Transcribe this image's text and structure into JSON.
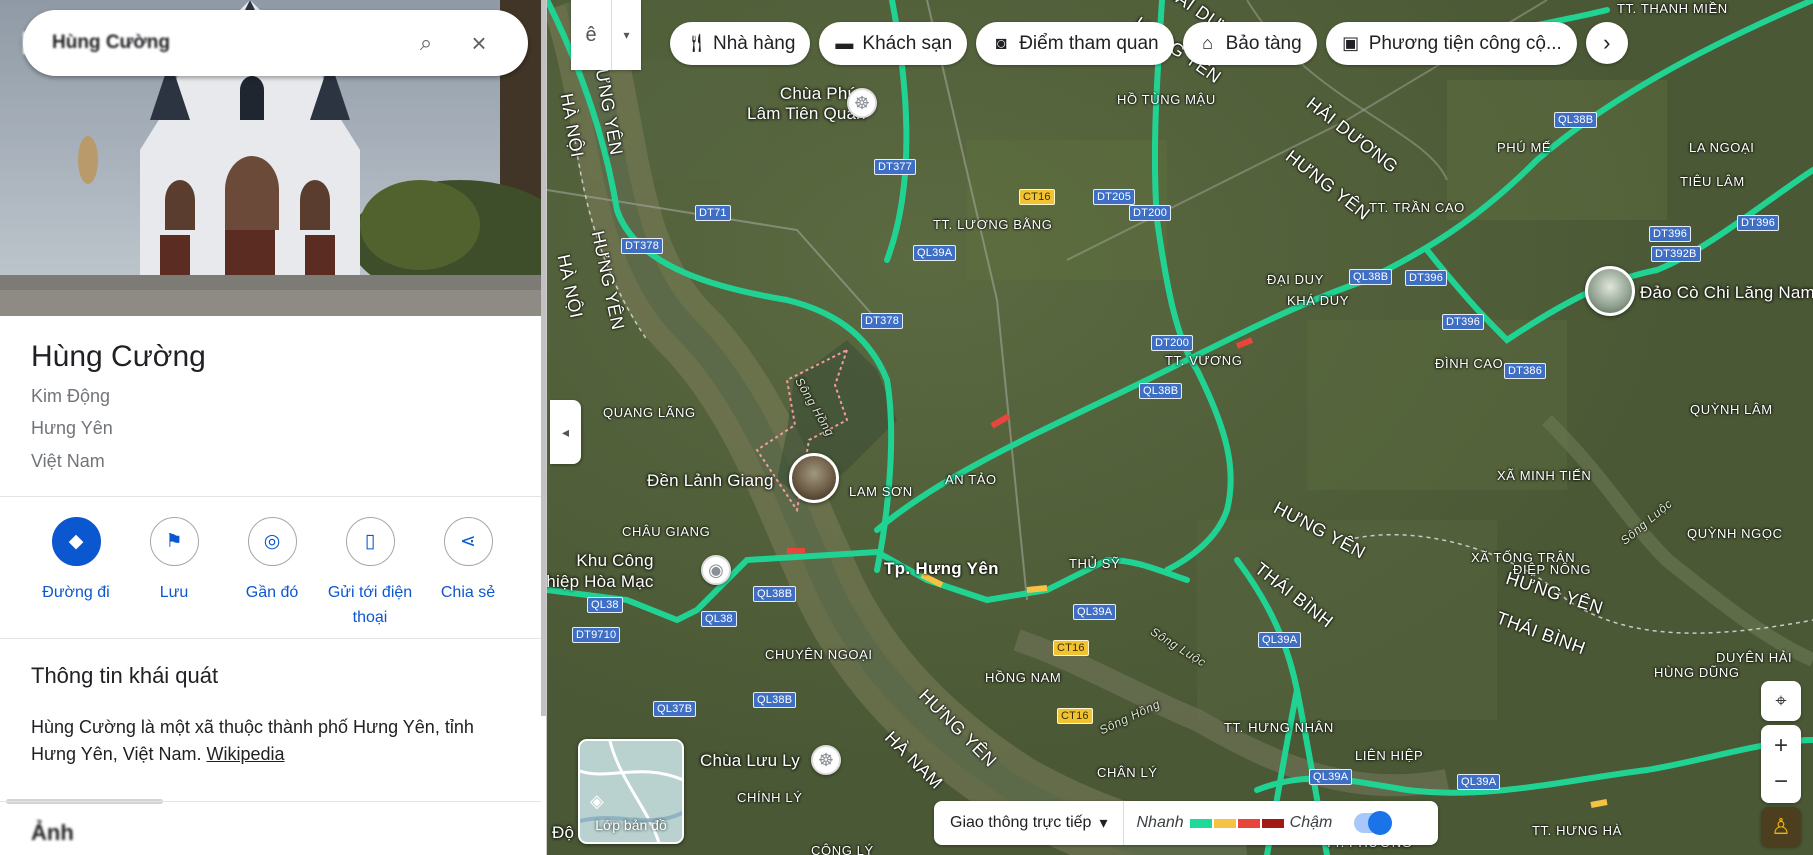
{
  "search": {
    "query": "Hùng Cường"
  },
  "place": {
    "title": "Hùng Cường",
    "address_lines": [
      "Kim Động",
      "Hưng Yên",
      "Việt Nam"
    ],
    "actions": [
      "Đường đi",
      "Lưu",
      "Gần đó",
      "Gửi tới điện thoại",
      "Chia sẻ"
    ],
    "overview_title": "Thông tin khái quát",
    "overview_text": "Hùng Cường là một xã thuộc thành phố Hưng Yên, tỉnh Hưng Yên, Việt Nam.",
    "overview_link": "Wikipedia",
    "photos_title": "Ảnh"
  },
  "map": {
    "ime_label": "ê",
    "chips": [
      {
        "icon": "fork-knife-icon",
        "label": "Nhà hàng"
      },
      {
        "icon": "bed-icon",
        "label": "Khách sạn"
      },
      {
        "icon": "camera-icon",
        "label": "Điểm tham quan"
      },
      {
        "icon": "museum-icon",
        "label": "Bảo tàng"
      },
      {
        "icon": "transit-icon",
        "label": "Phương tiện công cộ..."
      }
    ],
    "place_labels": {
      "thanh_mien": "TT. THANH MIỀN",
      "ho_tung_mau": "HỒ TÙNG MẬU",
      "phu_me": "PHÚ MẾ",
      "la_ngoai": "LA NGOẠI",
      "tieu_lam": "TIÊU LÂM",
      "luong_bang": "TT. LƯƠNG BẰNG",
      "tran_cao": "TT. TRẦN CAO",
      "dai_duy": "ĐẠI DUY",
      "kha_duy": "KHÁ DUY",
      "tt_vuong": "TT. VƯƠNG",
      "dinh_cao": "ĐÌNH CAO",
      "quang_lang": "QUANG LÃNG",
      "quynh_lam": "QUỲNH LÂM",
      "lam_son": "LAM SƠN",
      "an_tao": "AN TẢO",
      "xa_minh_tien": "XÃ MINH TIẾN",
      "chau_giang": "CHÂU GIANG",
      "thu_sy": "THỦ SỸ",
      "quynh_ngoc": "QUỲNH NGỌC",
      "xa_tong_tran": "XÃ TỐNG TRÂN",
      "diep_nong": "ĐIỆP NÔNG",
      "chuyen_ngoai": "CHUYÊN NGOẠI",
      "hong_nam": "HỒNG NAM",
      "hung_dung": "HÙNG DŨNG",
      "duyen_hai": "DUYÊN HẢI",
      "tt_hung_nhan": "TT. HƯNG NHÂN",
      "chan_ly": "CHÂN LÝ",
      "lien_hiep": "LIÊN HIỆP",
      "chinh_ly": "CHÍNH LÝ",
      "tt_phuong": "TT. PHƯƠNG",
      "tt_hung_ha": "TT. HƯNG HÀ",
      "cong_ly": "CÔNG LÝ",
      "tp_hung_yen": "Tp. Hưng Yên"
    },
    "province_labels": {
      "hung_yen_a": "HƯNG YÊN",
      "hung_yen_b": "HƯNG YÊN",
      "hung_yen_c": "HƯNG YÊN",
      "hung_yen_d": "HƯNG YÊN",
      "hung_yen_e": "HƯNG YÊN",
      "hung_yen_f": "HƯNG YÊN",
      "hung_yen_g": "HƯNG YÊN",
      "ha_noi_a": "HÀ NỘI",
      "ha_noi_b": "HÀ NỘI",
      "hai_duong_a": "HẢI DƯƠNG",
      "hai_duong_b": "HẢI DƯƠNG",
      "thai_binh_a": "THÁI BÌNH",
      "thai_binh_b": "THÁI BÌNH",
      "ha_nam": "HÀ NAM"
    },
    "river_labels": {
      "song_hong_a": "Sông Hồng",
      "song_hong_b": "Sông Hồng",
      "song_luoc_a": "Sông Luộc",
      "song_luoc_b": "Sông Luộc"
    },
    "shields": {
      "dt377": "DT377",
      "dt71": "DT71",
      "dt378a": "DT378",
      "dt378b": "DT378",
      "ql39a_a": "QL39A",
      "ql39a_b": "QL39A",
      "ql39a_c": "QL39A",
      "ql39a_d": "QL39A",
      "ql39a_e": "QL39A",
      "ct16_a": "CT16",
      "ct16_b": "CT16",
      "ct16_c": "CT16",
      "dt205": "DT205",
      "dt200a": "DT200",
      "dt200b": "DT200",
      "ql38b_a": "QL38B",
      "ql38b_b": "QL38B",
      "ql38b_c": "QL38B",
      "ql38b_d": "QL38B",
      "ql38b_e": "QL38B",
      "dt396a": "DT396",
      "dt396b": "DT396",
      "dt396c": "DT396",
      "dt396d": "DT396",
      "dt392b": "DT392B",
      "dt386": "DT386",
      "ql38_a": "QL38",
      "ql38_b": "QL38",
      "dt9710": "DT9710",
      "ql37b": "QL37B"
    },
    "pois": {
      "chua_phuc": "Chùa Phúc\nLâm Tiên Quán",
      "den_lanh_giang": "Đền Lảnh Giang",
      "khu_cong_nghiep": "Khu Công\nnghiệp Hòa Mạc",
      "chua_luu_ly": "Chùa Lưu Ly",
      "dao_co": "Đảo Cò Chi Lăng Nam",
      "bottom_d": "Độ"
    },
    "layers_label": "Lớp bản đồ",
    "traffic": {
      "mode": "Giao thông trực tiếp",
      "fast": "Nhanh",
      "slow": "Chậm",
      "colors": [
        "#1ed99a",
        "#f5c344",
        "#e8453c",
        "#a11b14"
      ],
      "enabled": true
    }
  }
}
